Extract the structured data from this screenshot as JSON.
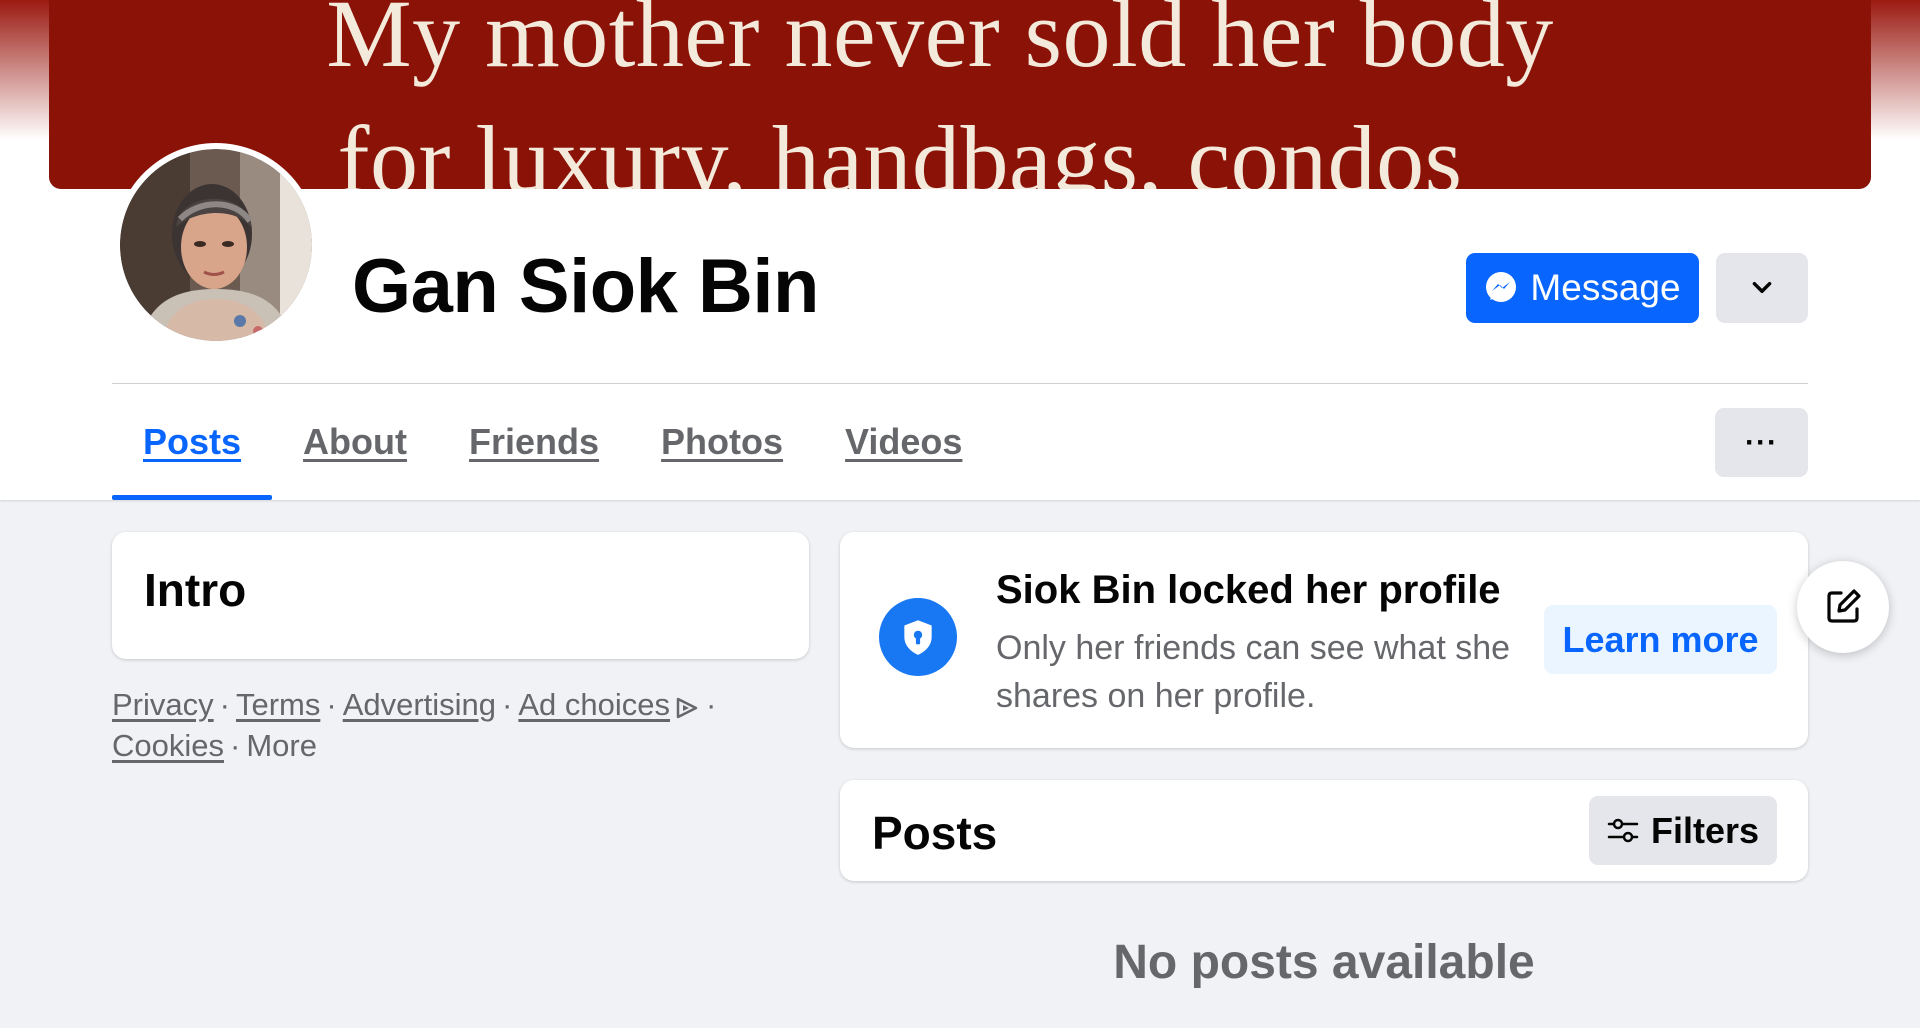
{
  "cover": {
    "line1": "My mother never sold her body",
    "line2": "for luxury, handbags, condos",
    "color": "#8a1206"
  },
  "profile": {
    "name": "Gan Siok Bin"
  },
  "actions": {
    "message_label": "Message",
    "dropdown_icon": "chevron-down-icon",
    "more_label": "···"
  },
  "tabs": [
    {
      "label": "Posts",
      "active": true
    },
    {
      "label": "About",
      "active": false
    },
    {
      "label": "Friends",
      "active": false
    },
    {
      "label": "Photos",
      "active": false
    },
    {
      "label": "Videos",
      "active": false
    }
  ],
  "intro": {
    "title": "Intro"
  },
  "footer": {
    "privacy": "Privacy",
    "terms": "Terms",
    "advertising": "Advertising",
    "ad_choices": "Ad choices",
    "cookies": "Cookies",
    "more": "More",
    "separator": "·"
  },
  "locked": {
    "title": "Siok Bin locked her profile",
    "description": "Only her friends can see what she shares on her profile.",
    "learn_more": "Learn more"
  },
  "posts": {
    "title": "Posts",
    "filters_label": "Filters",
    "empty_text": "No posts available"
  },
  "colors": {
    "accent": "#0866ff",
    "page_bg": "#f0f2f5",
    "secondary_button": "#e4e6eb",
    "muted_text": "#65676b"
  }
}
